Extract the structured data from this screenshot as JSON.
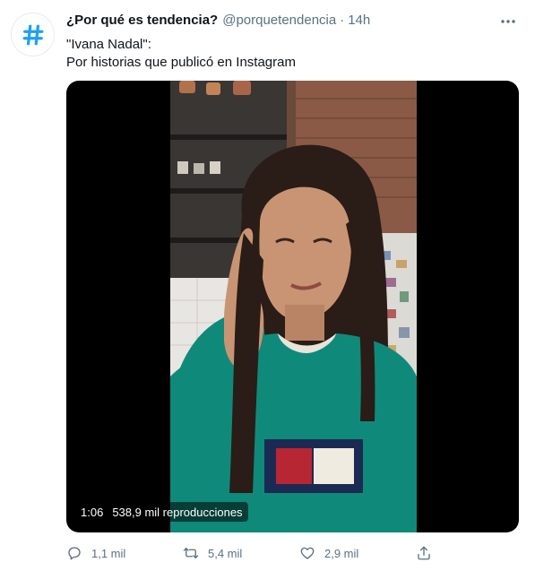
{
  "tweet": {
    "author": {
      "name": "¿Por qué es tendencia?",
      "handle": "@porquetendencia",
      "separator": "·",
      "time": "14h",
      "avatar_icon": "hashtag-icon",
      "avatar_color": "#1da1f2"
    },
    "text_lines": [
      "\"Ivana Nadal\":",
      "Por historias que publicó en Instagram"
    ],
    "media": {
      "duration": "1:06",
      "views": "538,9 mil reproducciones"
    },
    "actions": {
      "reply": {
        "icon": "reply-icon",
        "count": "1,1 mil"
      },
      "retweet": {
        "icon": "retweet-icon",
        "count": "5,4 mil"
      },
      "like": {
        "icon": "heart-icon",
        "count": "2,9 mil"
      },
      "share": {
        "icon": "share-icon"
      }
    },
    "more_icon": "more-options-icon"
  },
  "colors": {
    "text": "#0f1419",
    "secondary": "#5b7083",
    "accent": "#1da1f2",
    "sweater": "#0f8a7a"
  }
}
